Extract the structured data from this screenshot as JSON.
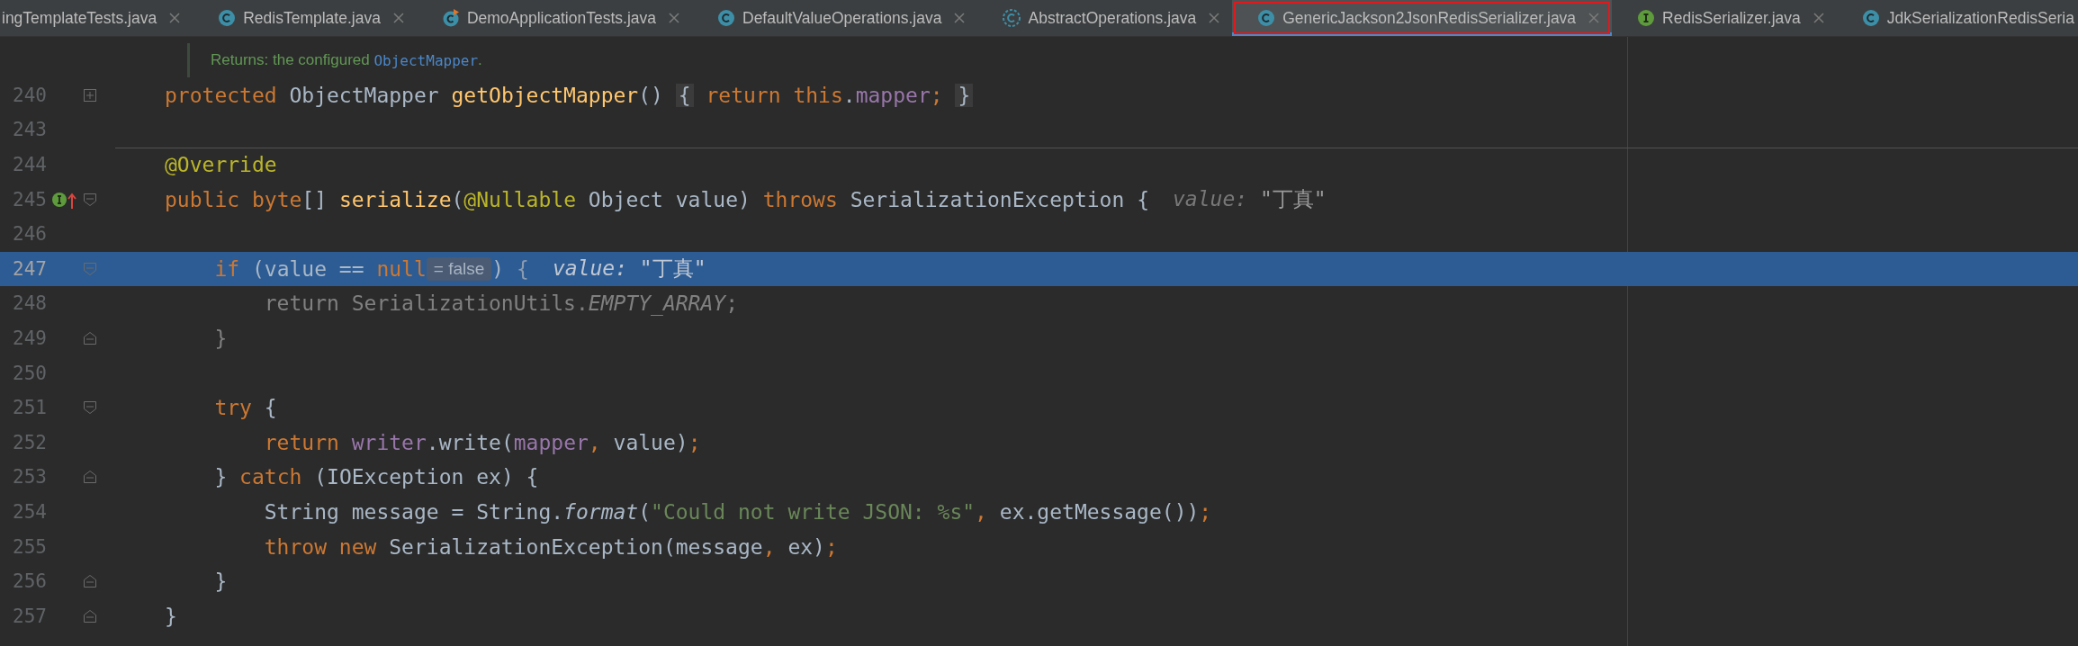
{
  "tabs": [
    {
      "label": "ingTemplateTests.java",
      "kind": "plain",
      "selected": false,
      "outlined": false,
      "closable": true
    },
    {
      "label": "RedisTemplate.java",
      "kind": "class",
      "selected": false,
      "outlined": false,
      "closable": true
    },
    {
      "label": "DemoApplicationTests.java",
      "kind": "runnable",
      "selected": false,
      "outlined": false,
      "closable": true
    },
    {
      "label": "DefaultValueOperations.java",
      "kind": "class",
      "selected": false,
      "outlined": false,
      "closable": true
    },
    {
      "label": "AbstractOperations.java",
      "kind": "abstract",
      "selected": false,
      "outlined": false,
      "closable": true
    },
    {
      "label": "GenericJackson2JsonRedisSerializer.java",
      "kind": "class",
      "selected": true,
      "outlined": true,
      "closable": true
    },
    {
      "label": "RedisSerializer.java",
      "kind": "interface",
      "selected": false,
      "outlined": false,
      "closable": true
    },
    {
      "label": "JdkSerializationRedisSeria",
      "kind": "class",
      "selected": false,
      "outlined": false,
      "closable": false
    }
  ],
  "editor": {
    "rows": [
      {
        "current": false,
        "separator_above": false,
        "markers": [],
        "segments": [
          {
            "kind": "doc",
            "tokens": [
              {
                "text": "Returns:",
                "kind": "doc"
              },
              {
                "text": " the configured ",
                "kind": "doc"
              },
              {
                "text": "ObjectMapper",
                "kind": "doccode"
              },
              {
                "text": ".",
                "kind": "doc"
              }
            ]
          }
        ]
      },
      {
        "number": "240",
        "current": false,
        "separator_above": false,
        "markers": [
          {
            "kind": "expand"
          }
        ],
        "segments": [
          {
            "kind": "code",
            "tokens": [
              {
                "text": "protected ",
                "kind": "kw"
              },
              {
                "text": "ObjectMapper ",
                "kind": "id"
              },
              {
                "text": "getObjectMapper",
                "kind": "fn"
              },
              {
                "text": "() ",
                "kind": "id"
              },
              {
                "text": "{",
                "kind": "foldbrace"
              },
              {
                "text": " return ",
                "kind": "kw"
              },
              {
                "text": "this",
                "kind": "kw"
              },
              {
                "text": ".",
                "kind": "id"
              },
              {
                "text": "mapper",
                "kind": "field"
              },
              {
                "text": "; ",
                "kind": "kw"
              },
              {
                "text": "}",
                "kind": "foldbrace"
              }
            ]
          }
        ]
      },
      {
        "number": "243",
        "current": false,
        "separator_above": false,
        "markers": [],
        "segments": []
      },
      {
        "number": "244",
        "current": false,
        "separator_above": true,
        "markers": [],
        "segments": [
          {
            "kind": "code",
            "tokens": [
              {
                "text": "@Override",
                "kind": "ann"
              }
            ]
          }
        ]
      },
      {
        "number": "245",
        "current": false,
        "separator_above": false,
        "markers": [
          {
            "kind": "implements"
          },
          {
            "kind": "fold-start"
          }
        ],
        "segments": [
          {
            "kind": "code",
            "tokens": [
              {
                "text": "public ",
                "kind": "kw"
              },
              {
                "text": "byte",
                "kind": "kw"
              },
              {
                "text": "[] ",
                "kind": "id"
              },
              {
                "text": "serialize",
                "kind": "fn"
              },
              {
                "text": "(",
                "kind": "id"
              },
              {
                "text": "@Nullable ",
                "kind": "ann"
              },
              {
                "text": "Object value) ",
                "kind": "id"
              },
              {
                "text": "throws ",
                "kind": "kw"
              },
              {
                "text": "SerializationException {",
                "kind": "id"
              }
            ]
          },
          {
            "kind": "hint",
            "tokens": [
              {
                "text": "value: ",
                "kind": "hintlabel"
              },
              {
                "text": "\"丁真\"",
                "kind": "hintstr"
              }
            ]
          }
        ]
      },
      {
        "number": "246",
        "current": false,
        "separator_above": false,
        "markers": [],
        "segments": []
      },
      {
        "number": "247",
        "current": true,
        "separator_above": false,
        "markers": [
          {
            "kind": "fold-start"
          }
        ],
        "segments": [
          {
            "kind": "code",
            "tokens": [
              {
                "text": "    if ",
                "kind": "kw"
              },
              {
                "text": "(value == ",
                "kind": "id"
              },
              {
                "text": "null",
                "kind": "kw"
              }
            ]
          },
          {
            "kind": "badge",
            "tokens": [
              {
                "text": "= false",
                "kind": "badge"
              }
            ]
          },
          {
            "kind": "code",
            "tokens": [
              {
                "text": ") ",
                "kind": "id"
              },
              {
                "text": "{",
                "kind": "dim"
              }
            ]
          },
          {
            "kind": "hint",
            "tokens": [
              {
                "text": "value: ",
                "kind": "hintlabel"
              },
              {
                "text": "\"丁真\"",
                "kind": "hintstr"
              }
            ]
          }
        ]
      },
      {
        "number": "248",
        "current": false,
        "separator_above": false,
        "markers": [],
        "segments": [
          {
            "kind": "code",
            "tokens": [
              {
                "text": "        return SerializationUtils.",
                "kind": "dim"
              },
              {
                "text": "EMPTY_ARRAY",
                "kind": "dimitalic"
              },
              {
                "text": ";",
                "kind": "dim"
              }
            ]
          }
        ]
      },
      {
        "number": "249",
        "current": false,
        "separator_above": false,
        "markers": [
          {
            "kind": "fold-end"
          }
        ],
        "segments": [
          {
            "kind": "code",
            "tokens": [
              {
                "text": "    }",
                "kind": "dim"
              }
            ]
          }
        ]
      },
      {
        "number": "250",
        "current": false,
        "separator_above": false,
        "markers": [],
        "segments": []
      },
      {
        "number": "251",
        "current": false,
        "separator_above": false,
        "markers": [
          {
            "kind": "fold-start"
          }
        ],
        "segments": [
          {
            "kind": "code",
            "tokens": [
              {
                "text": "    try ",
                "kind": "kw"
              },
              {
                "text": "{",
                "kind": "id"
              }
            ]
          }
        ]
      },
      {
        "number": "252",
        "current": false,
        "separator_above": false,
        "markers": [],
        "segments": [
          {
            "kind": "code",
            "tokens": [
              {
                "text": "        return ",
                "kind": "kw"
              },
              {
                "text": "writer",
                "kind": "field"
              },
              {
                "text": ".write(",
                "kind": "id"
              },
              {
                "text": "mapper",
                "kind": "field"
              },
              {
                "text": ", ",
                "kind": "kw"
              },
              {
                "text": "value)",
                "kind": "id"
              },
              {
                "text": ";",
                "kind": "kw"
              }
            ]
          }
        ]
      },
      {
        "number": "253",
        "current": false,
        "separator_above": false,
        "markers": [
          {
            "kind": "fold-end"
          }
        ],
        "segments": [
          {
            "kind": "code",
            "tokens": [
              {
                "text": "    } ",
                "kind": "id"
              },
              {
                "text": "catch ",
                "kind": "kw"
              },
              {
                "text": "(IOException ex) {",
                "kind": "id"
              }
            ]
          }
        ]
      },
      {
        "number": "254",
        "current": false,
        "separator_above": false,
        "markers": [],
        "segments": [
          {
            "kind": "code",
            "tokens": [
              {
                "text": "        String message = String.",
                "kind": "id"
              },
              {
                "text": "format",
                "kind": "italic"
              },
              {
                "text": "(",
                "kind": "id"
              },
              {
                "text": "\"Could not write JSON: %s\"",
                "kind": "str"
              },
              {
                "text": ", ",
                "kind": "kw"
              },
              {
                "text": "ex.getMessage())",
                "kind": "id"
              },
              {
                "text": ";",
                "kind": "kw"
              }
            ]
          }
        ]
      },
      {
        "number": "255",
        "current": false,
        "separator_above": false,
        "markers": [],
        "segments": [
          {
            "kind": "code",
            "tokens": [
              {
                "text": "        throw new ",
                "kind": "kw"
              },
              {
                "text": "SerializationException(message",
                "kind": "id"
              },
              {
                "text": ", ",
                "kind": "kw"
              },
              {
                "text": "ex)",
                "kind": "id"
              },
              {
                "text": ";",
                "kind": "kw"
              }
            ]
          }
        ]
      },
      {
        "number": "256",
        "current": false,
        "separator_above": false,
        "markers": [
          {
            "kind": "fold-end"
          }
        ],
        "segments": [
          {
            "kind": "code",
            "tokens": [
              {
                "text": "    }",
                "kind": "id"
              }
            ]
          }
        ]
      },
      {
        "number": "257",
        "current": false,
        "separator_above": false,
        "markers": [
          {
            "kind": "fold-end"
          }
        ],
        "segments": [
          {
            "kind": "code",
            "tokens": [
              {
                "text": "}",
                "kind": "id"
              }
            ]
          }
        ]
      }
    ]
  }
}
